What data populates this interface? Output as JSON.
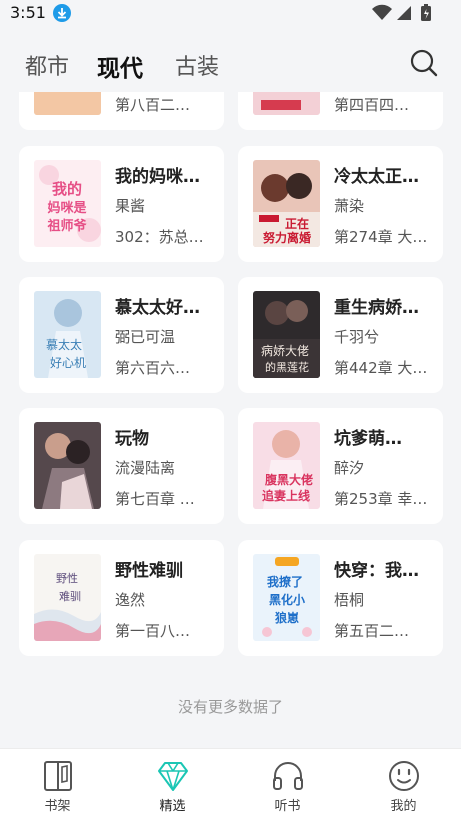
{
  "status": {
    "time": "3:51"
  },
  "tabs": [
    {
      "label": "都市"
    },
    {
      "label": "现代"
    },
    {
      "label": "古装"
    }
  ],
  "books": [
    {
      "title": "",
      "author": "",
      "chapter": "第八百二…"
    },
    {
      "title": "",
      "author": "",
      "chapter": "第四百四…"
    },
    {
      "title": "我的妈咪…",
      "author": "果酱",
      "chapter": "302：苏总…",
      "cover_text": "我的妈咪是祖师爷"
    },
    {
      "title": "冷太太正…",
      "author": "萧染",
      "chapter": "第274章 大…",
      "cover_text": "正在努力离婚"
    },
    {
      "title": "慕太太好…",
      "author": "弼已可温",
      "chapter": "第六百六…",
      "cover_text": "慕太太好心机"
    },
    {
      "title": "重生病娇…",
      "author": "千羽兮",
      "chapter": "第442章 大…",
      "cover_text": "病娇大佬的黑莲花"
    },
    {
      "title": "玩物",
      "author": "流漫陆离",
      "chapter": "第七百章 …",
      "cover_text": ""
    },
    {
      "title": "坑爹萌…",
      "author": "醉汐",
      "chapter": "第253章 幸…",
      "cover_text": "腹黑大佬追妻上线"
    },
    {
      "title": "野性难驯",
      "author": "逸然",
      "chapter": "第一百八…",
      "cover_text": "野性难驯"
    },
    {
      "title": "快穿：我…",
      "author": "梧桐",
      "chapter": "第五百二…",
      "cover_text": "我撩了黑化小狼崽"
    }
  ],
  "end_text": "没有更多数据了",
  "nav": [
    {
      "label": "书架",
      "icon": "bookshelf-icon"
    },
    {
      "label": "精选",
      "icon": "diamond-icon"
    },
    {
      "label": "听书",
      "icon": "headphones-icon"
    },
    {
      "label": "我的",
      "icon": "smiley-icon"
    }
  ],
  "colors": {
    "accent": "#1bc6b4",
    "background": "#f4f5f7",
    "card": "#ffffff"
  }
}
